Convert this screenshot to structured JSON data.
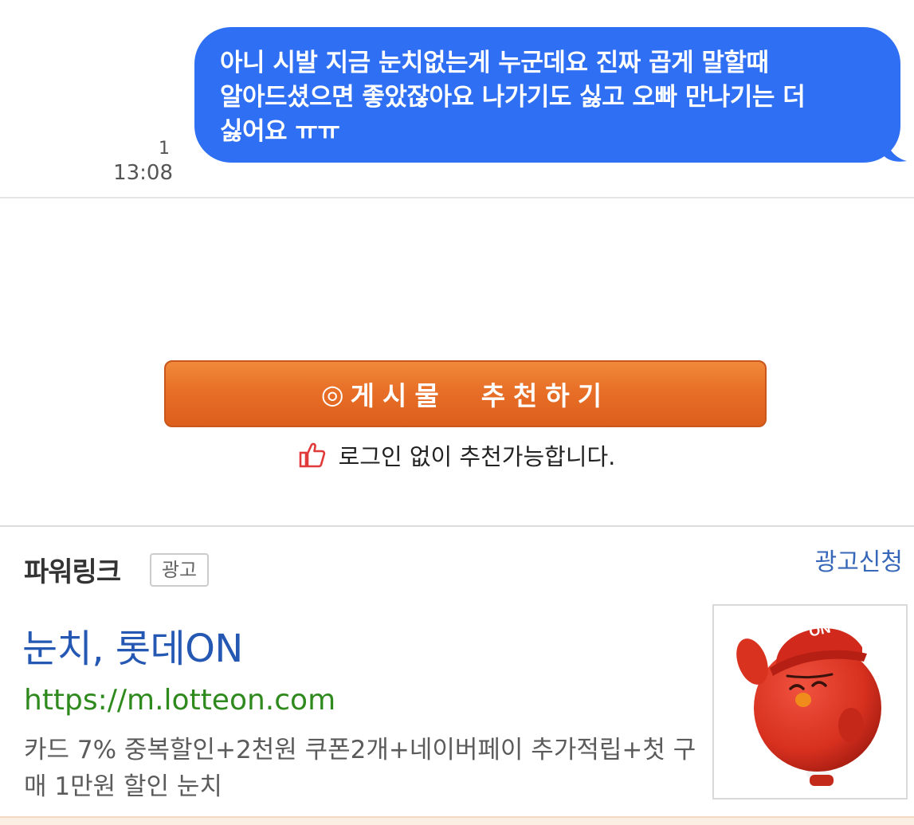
{
  "chat": {
    "message": "아니 시발 지금 눈치없는게 누군데요 진짜 곱게 말할때 알아드셨으면 좋았잖아요 나가기도 싫고 오빠 만나기는 더 싫어요 ㅠㅠ",
    "message_lines": [
      "아니 시발 지금 눈치없는게 누군데요 진짜 곱게 말할때",
      "알아드셨으면 좋았잖아요 나가기도 싫고 오빠 만나기는 더",
      "싫어요 ㅠㅠ"
    ],
    "unread_count": "1",
    "time": "13:08",
    "bubble_color": "#2f6ff3"
  },
  "recommend": {
    "button_icon": "◎",
    "button_label": "게시물  추천하기",
    "note": "로그인 없이 추천가능합니다.",
    "thumb_icon": "thumbs-up-icon",
    "button_color": "#e86f27"
  },
  "power_link": {
    "title": "파워링크",
    "badge": "광고",
    "apply_label": "광고신청",
    "ad": {
      "headline": "눈치, 롯데ON",
      "url": "https://m.lotteon.com",
      "description": "카드 7% 중복할인+2천원 쿠폰2개+네이버페이 추가적립+첫 구매 1만원 할인 눈치",
      "cap_text": "ON",
      "image_icon": "lotteon-mascot-icon"
    },
    "headline_color": "#2458b3",
    "url_color": "#2f8a1e"
  }
}
